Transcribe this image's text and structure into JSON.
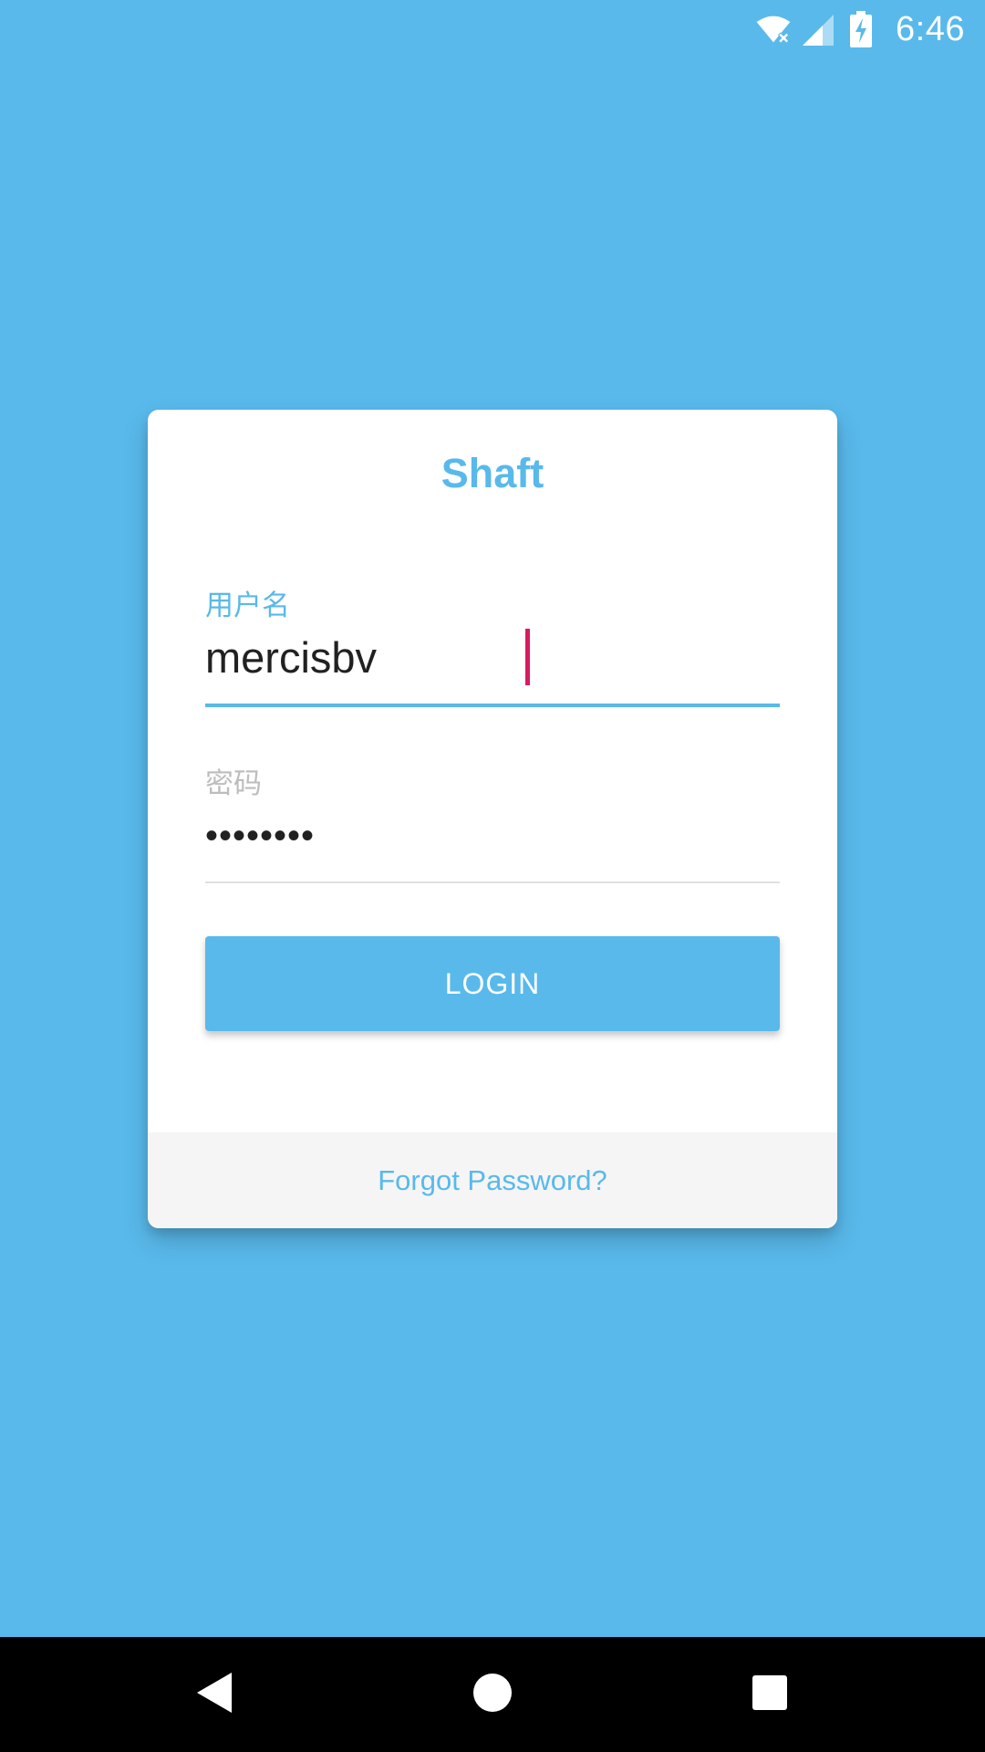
{
  "status_bar": {
    "time": "6:46",
    "icons": [
      "wifi-no-internet-icon",
      "cell-signal-icon",
      "battery-charging-icon"
    ]
  },
  "login_card": {
    "title": "Shaft",
    "username": {
      "label": "用户名",
      "value": "mercisbv"
    },
    "password": {
      "label": "密码",
      "value": "••••••••"
    },
    "login_button": "LOGIN",
    "forgot_link": "Forgot Password?"
  },
  "nav_bar": {
    "icons": [
      "back-icon",
      "home-icon",
      "recents-icon"
    ]
  },
  "colors": {
    "background": "#59b9eb",
    "accent": "#59b9eb",
    "caret": "#d81b60"
  }
}
